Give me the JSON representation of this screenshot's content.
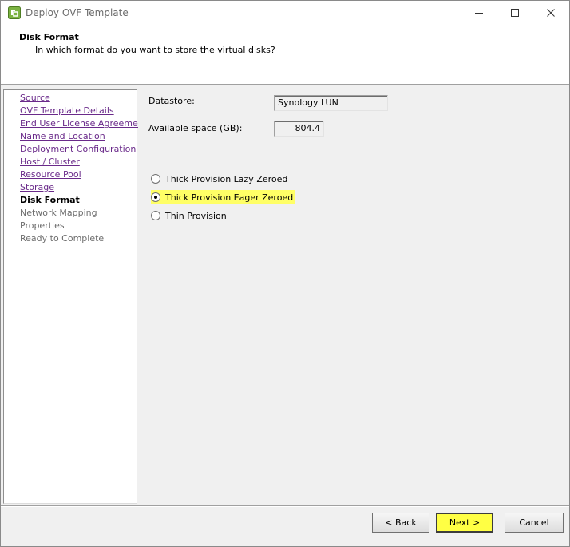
{
  "window": {
    "title": "Deploy OVF Template",
    "icon": "vsphere-icon"
  },
  "header": {
    "title": "Disk Format",
    "subtitle": "In which format do you want to store the virtual disks?"
  },
  "nav": {
    "items": [
      {
        "label": "Source",
        "state": "link"
      },
      {
        "label": "OVF Template Details",
        "state": "link"
      },
      {
        "label": "End User License Agreement",
        "state": "link"
      },
      {
        "label": "Name and Location",
        "state": "link"
      },
      {
        "label": "Deployment Configuration",
        "state": "link"
      },
      {
        "label": "Host / Cluster",
        "state": "link"
      },
      {
        "label": "Resource Pool",
        "state": "link"
      },
      {
        "label": "Storage",
        "state": "link"
      },
      {
        "label": "Disk Format",
        "state": "current"
      },
      {
        "label": "Network Mapping",
        "state": "pending"
      },
      {
        "label": "Properties",
        "state": "pending"
      },
      {
        "label": "Ready to Complete",
        "state": "pending"
      }
    ]
  },
  "form": {
    "datastore_label": "Datastore:",
    "datastore_value": "Synology LUN",
    "space_label": "Available space (GB):",
    "space_value": "804.4",
    "options": [
      {
        "label": "Thick Provision Lazy Zeroed",
        "selected": false
      },
      {
        "label": "Thick Provision Eager Zeroed",
        "selected": true
      },
      {
        "label": "Thin Provision",
        "selected": false
      }
    ]
  },
  "buttons": {
    "back": "< Back",
    "next": "Next >",
    "cancel": "Cancel"
  },
  "colors": {
    "highlight": "#ffff44",
    "link": "#6a2a8a",
    "pending": "#6d6d6d"
  }
}
